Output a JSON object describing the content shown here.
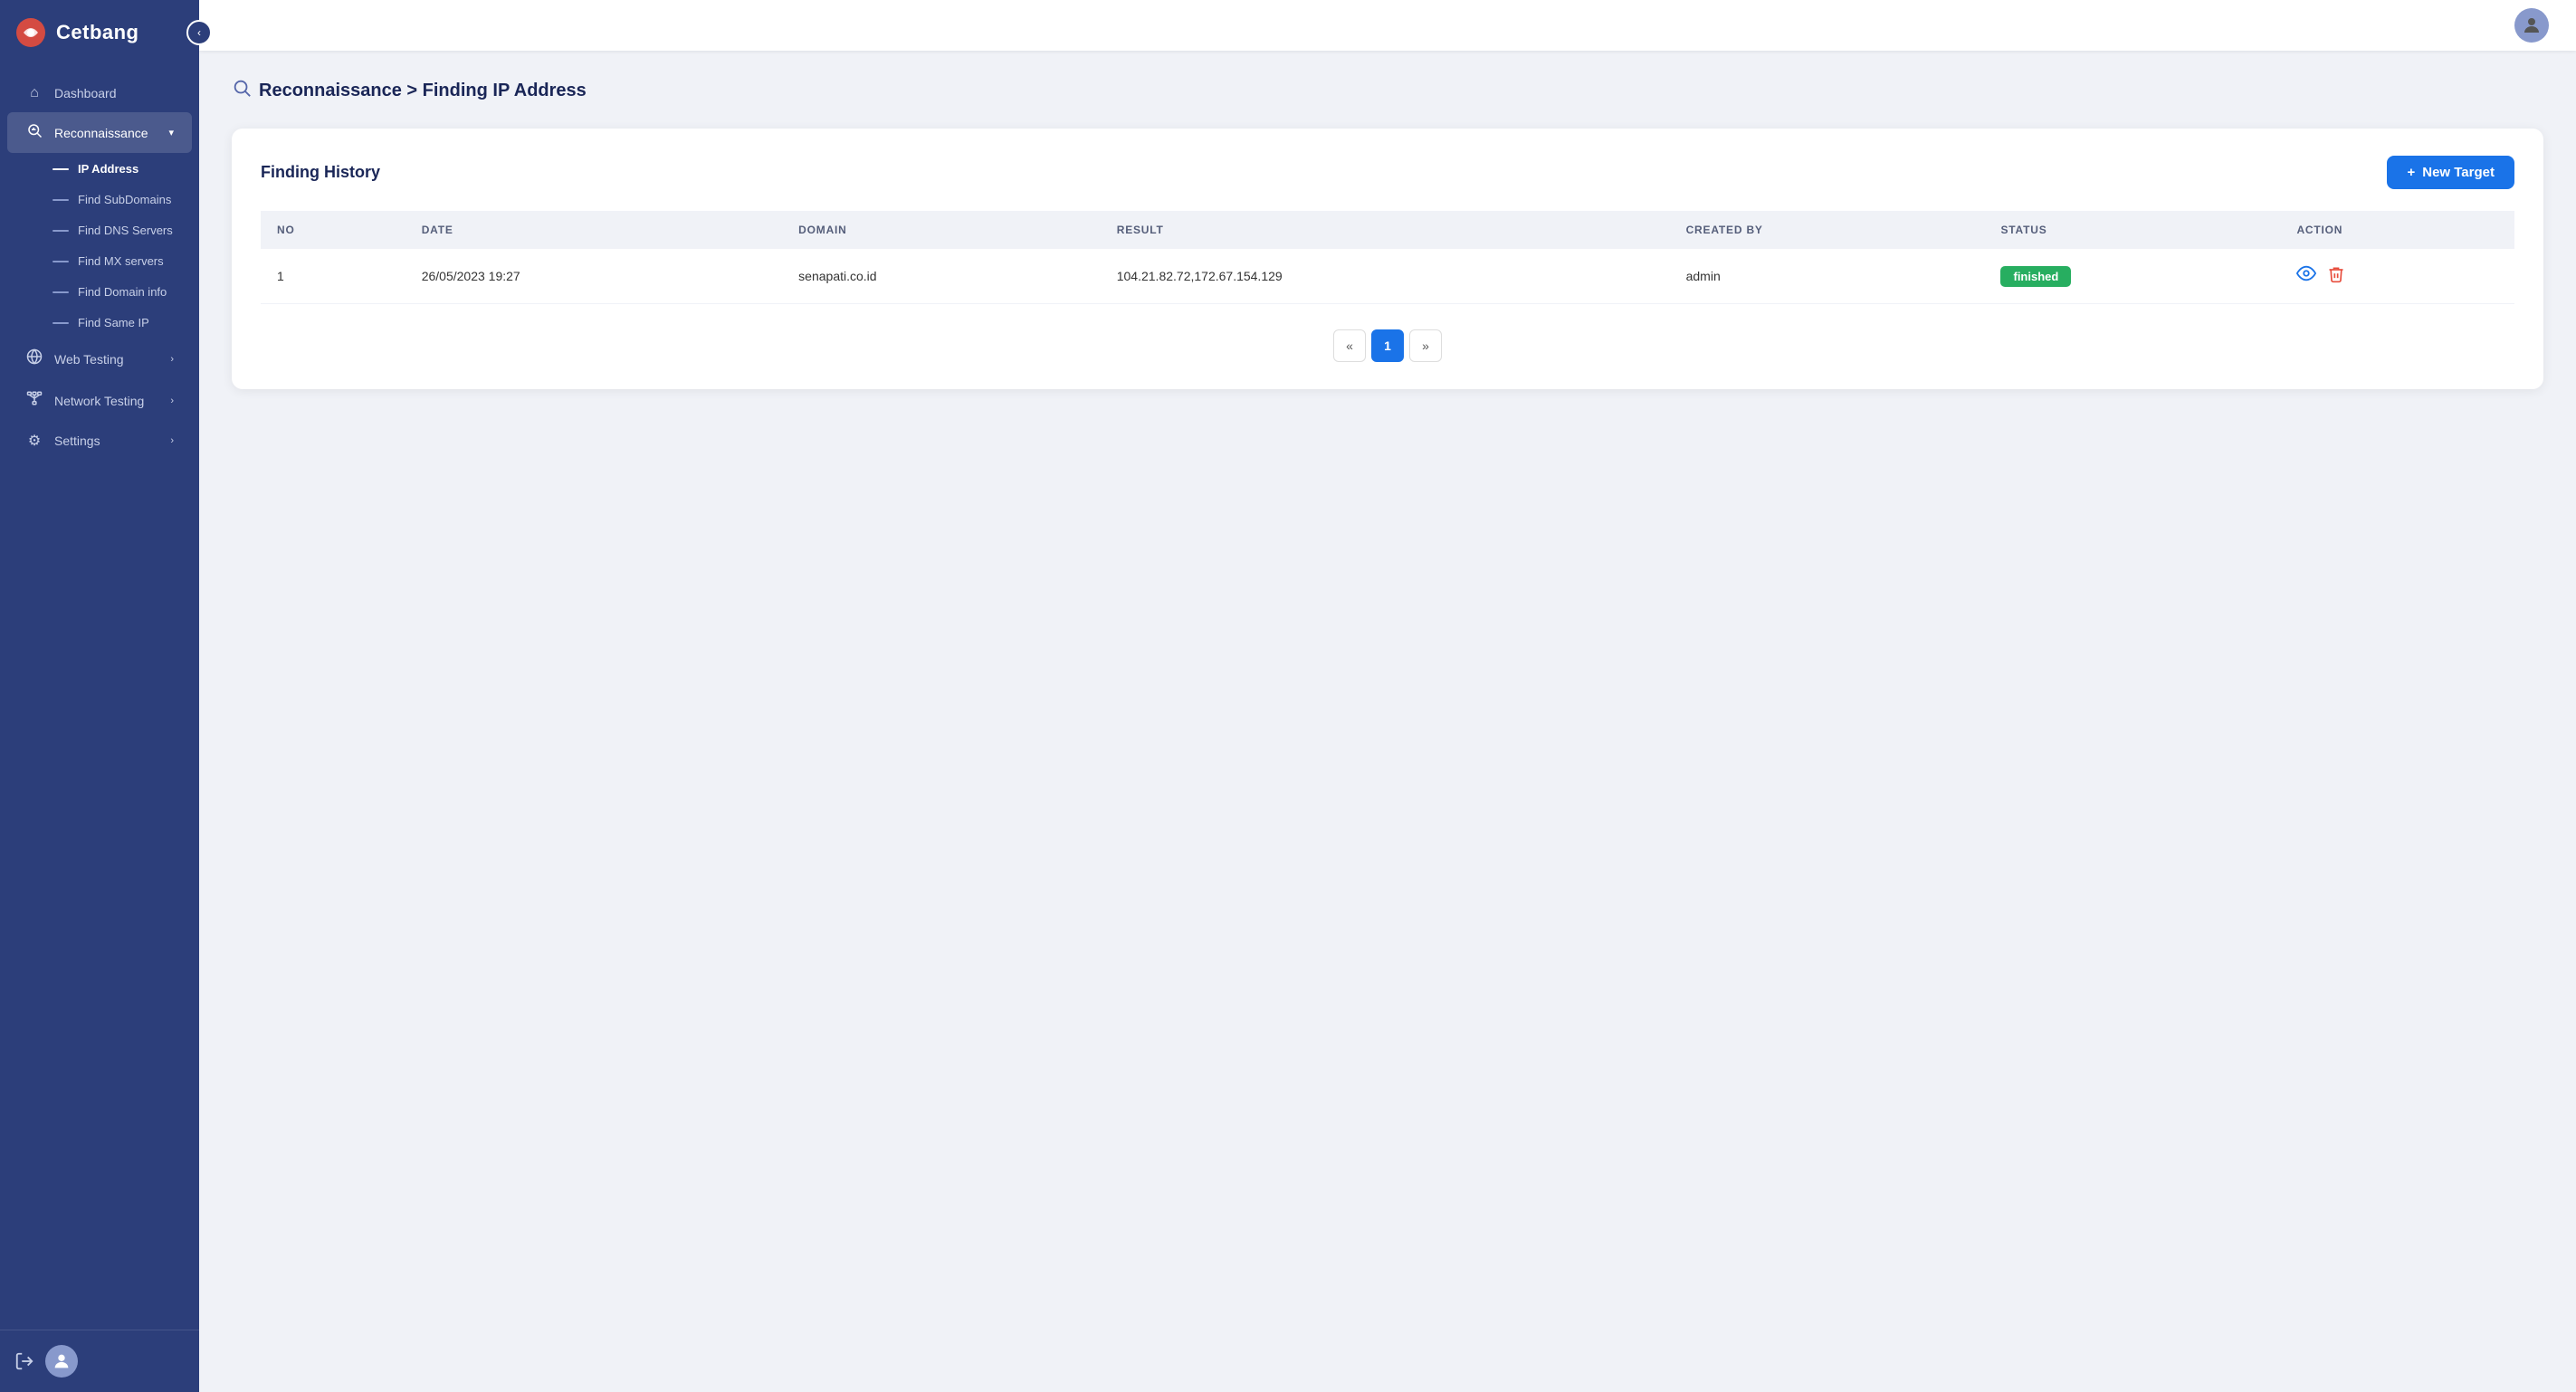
{
  "app": {
    "name": "Cetbang"
  },
  "sidebar": {
    "collapse_label": "‹",
    "items": [
      {
        "id": "dashboard",
        "label": "Dashboard",
        "icon": "⌂",
        "active": false,
        "expandable": false
      },
      {
        "id": "reconnaissance",
        "label": "Reconnaissance",
        "icon": "🔎",
        "active": true,
        "expandable": true
      }
    ],
    "sub_items": [
      {
        "id": "ip-address",
        "label": "IP Address",
        "active": true
      },
      {
        "id": "find-subdomains",
        "label": "Find SubDomains",
        "active": false
      },
      {
        "id": "find-dns-servers",
        "label": "Find DNS Servers",
        "active": false
      },
      {
        "id": "find-mx-servers",
        "label": "Find MX servers",
        "active": false
      },
      {
        "id": "find-domain-info",
        "label": "Find Domain info",
        "active": false
      },
      {
        "id": "find-same-ip",
        "label": "Find Same IP",
        "active": false
      }
    ],
    "bottom_items": [
      {
        "id": "web-testing",
        "label": "Web Testing",
        "icon": "🌐",
        "expandable": true
      },
      {
        "id": "network-testing",
        "label": "Network Testing",
        "icon": "📡",
        "expandable": true
      },
      {
        "id": "settings",
        "label": "Settings",
        "icon": "⚙",
        "expandable": true
      }
    ],
    "logout_icon": "⟳",
    "footer_avatar": "👤"
  },
  "topbar": {
    "avatar": "👤"
  },
  "breadcrumb": {
    "icon": "🔎",
    "path": "Reconnaissance > Finding IP Address"
  },
  "card": {
    "title": "Finding History",
    "new_target_label": "New Target",
    "new_target_plus": "+"
  },
  "table": {
    "headers": [
      "NO",
      "DATE",
      "DOMAIN",
      "RESULT",
      "CREATED BY",
      "STATUS",
      "ACTION"
    ],
    "rows": [
      {
        "no": "1",
        "date": "26/05/2023 19:27",
        "domain": "senapati.co.id",
        "result": "104.21.82.72,172.67.154.129",
        "created_by": "admin",
        "status": "finished",
        "status_color": "#27ae60"
      }
    ]
  },
  "pagination": {
    "prev": "«",
    "next": "»",
    "current": "1"
  }
}
